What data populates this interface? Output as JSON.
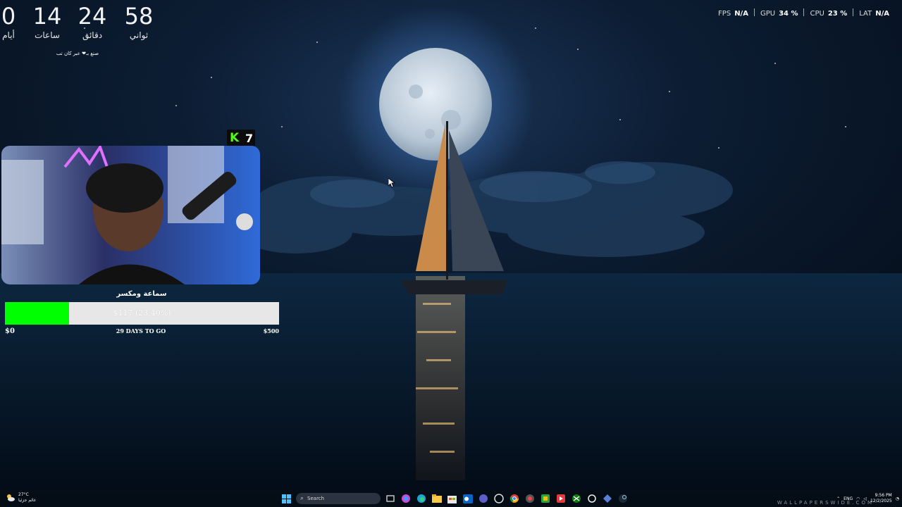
{
  "countdown": {
    "days": {
      "value": "0",
      "label": "أيام"
    },
    "hours": {
      "value": "14",
      "label": "ساعات"
    },
    "minutes": {
      "value": "24",
      "label": "دقائق"
    },
    "seconds": {
      "value": "58",
      "label": "ثواني"
    },
    "credit": "صنع بـ❤ عبر كان تب"
  },
  "overlay_stats": [
    {
      "name": "FPS",
      "value": "N/A"
    },
    {
      "name": "GPU",
      "value": "34 %"
    },
    {
      "name": "CPU",
      "value": "23 %"
    },
    {
      "name": "LAT",
      "value": "N/A"
    }
  ],
  "kick": {
    "logo": "K",
    "viewers": "7",
    "color": "#53fc18"
  },
  "donation_goal": {
    "title": "سماعة ومكسر",
    "amount_text": "$117 (23.40%)",
    "progress_fraction": 0.234,
    "min_label": "$0",
    "max_label": "$500",
    "days_left": "29 DAYS TO GO",
    "fill_color": "#00ff00"
  },
  "taskbar": {
    "weather_temp": "27°C",
    "weather_desc": "غائم جزئيا",
    "search_placeholder": "Search",
    "apps": [
      "windows-start-icon",
      "task-view-icon",
      "copilot-icon",
      "edge-icon",
      "file-explorer-icon",
      "store-icon",
      "outlook-icon",
      "teams-icon",
      "obs-icon",
      "chrome-icon",
      "spotify-icon",
      "app-green-icon",
      "app-red-icon",
      "xbox-icon",
      "app-circle-icon",
      "app-blue-icon",
      "steam-icon"
    ],
    "tray_lang": "ENG",
    "clock_time": "9:56 PM",
    "clock_date": "12/2/2025"
  },
  "watermark": "WALLPAPERSWIDE.COM",
  "colors": {
    "moon_glow": "#4a90ff",
    "sea": "#061a2e",
    "sail": "#c98a4a"
  }
}
